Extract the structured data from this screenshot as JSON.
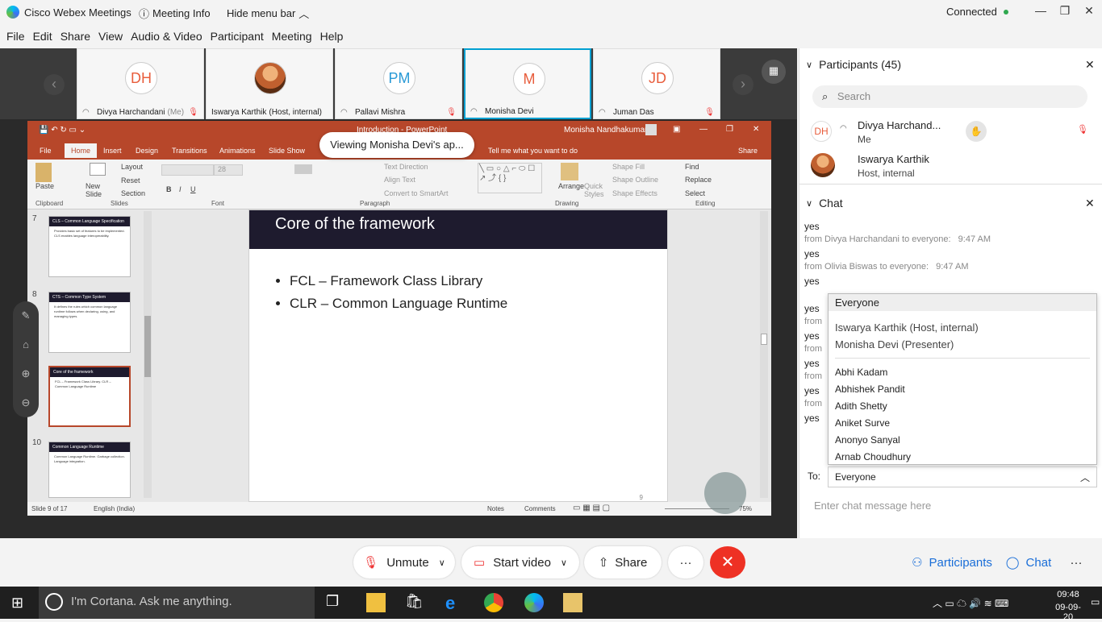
{
  "titlebar": {
    "app": "Cisco Webex Meetings",
    "meeting_info": "Meeting Info",
    "hide_menu": "Hide menu bar",
    "connection": "Connected"
  },
  "menu": [
    "File",
    "Edit",
    "Share",
    "View",
    "Audio & Video",
    "Participant",
    "Meeting",
    "Help"
  ],
  "thumbnails": [
    {
      "initials": "DH",
      "name": "Divya Harchandani",
      "suffix": "(Me)"
    },
    {
      "initials": "",
      "name": "Iswarya Karthik",
      "suffix": "(Host, internal)"
    },
    {
      "initials": "PM",
      "name": "Pallavi Mishra",
      "suffix": ""
    },
    {
      "initials": "M",
      "name": "Monisha Devi",
      "suffix": ""
    },
    {
      "initials": "JD",
      "name": "Juman Das",
      "suffix": ""
    }
  ],
  "banner": "Viewing Monisha Devi's ap...",
  "ppt": {
    "title": "Introduction - PowerPoint",
    "user": "Monisha Nandhakumar",
    "tabs": [
      "File",
      "Home",
      "Insert",
      "Design",
      "Transitions",
      "Animations",
      "Slide Show"
    ],
    "tell_me": "Tell me what you want to do",
    "share": "Share",
    "ribbon": {
      "paste": "Paste",
      "new_slide": "New Slide",
      "layout": "Layout",
      "reset": "Reset",
      "section": "Section",
      "font_size": "28",
      "text_direction": "Text Direction",
      "align_text": "Align Text",
      "convert": "Convert to SmartArt",
      "arrange": "Arrange",
      "quick_styles": "Quick Styles",
      "shape_fill": "Shape Fill",
      "shape_outline": "Shape Outline",
      "shape_effects": "Shape Effects",
      "find": "Find",
      "replace": "Replace",
      "select": "Select",
      "groups": [
        "Clipboard",
        "Slides",
        "Font",
        "Paragraph",
        "Drawing",
        "Editing"
      ]
    },
    "slides": [
      {
        "no": "7",
        "title": "CLS – Common Language Specification",
        "text": "Provides basic set of features to be implemented. CLS enables language interoperability."
      },
      {
        "no": "8",
        "title": "CTS – Common Type System",
        "text": "It defines the rules which common language runtime follows when declaring, using, and managing types."
      },
      {
        "no": "9",
        "title": "Core of the framework",
        "text": "FCL – Framework Class Library. CLR – Common Language Runtime"
      },
      {
        "no": "10",
        "title": "Common Language Runtime",
        "text": "Common Language Runtime. Garbage collection. Language integration."
      }
    ],
    "slide": {
      "heading": "Core of the framework",
      "bullets": [
        "FCL – Framework Class Library",
        "CLR – Common Language Runtime"
      ],
      "page": "9"
    },
    "status": {
      "slide": "Slide 9 of 17",
      "lang": "English (India)",
      "notes": "Notes",
      "comments": "Comments",
      "zoom": "75%"
    }
  },
  "participants": {
    "header": "Participants (45)",
    "search_placeholder": "Search",
    "list": [
      {
        "initials": "DH",
        "name": "Divya Harchand...",
        "sub": "Me"
      },
      {
        "initials": "",
        "name": "Iswarya Karthik",
        "sub": "Host, internal"
      }
    ]
  },
  "chat": {
    "header": "Chat",
    "messages": [
      {
        "text": "yes",
        "meta": "from Divya Harchandani to everyone:",
        "time": "9:47 AM"
      },
      {
        "text": "yes",
        "meta": "from Olivia Biswas to everyone:",
        "time": "9:47 AM"
      },
      {
        "text": "yes",
        "meta": "",
        "time": ""
      },
      {
        "text": "yes",
        "meta": "from",
        "time": ""
      },
      {
        "text": "yes",
        "meta": "from",
        "time": ""
      },
      {
        "text": "yes",
        "meta": "from",
        "time": ""
      },
      {
        "text": "yes",
        "meta": "from",
        "time": ""
      },
      {
        "text": "yes",
        "meta": "",
        "time": ""
      }
    ],
    "dropdown": {
      "selected": "Everyone",
      "roles": [
        "Iswarya Karthik (Host, internal)",
        "Monisha Devi (Presenter)"
      ],
      "people": [
        "Abhi Kadam",
        "Abhishek Pandit",
        "Adith Shetty",
        "Aniket Surve",
        "Anonyo Sanyal",
        "Arnab Choudhury"
      ]
    },
    "to_label": "To:",
    "to_value": "Everyone",
    "input_placeholder": "Enter chat message here"
  },
  "controls": {
    "unmute": "Unmute",
    "start_video": "Start video",
    "share": "Share",
    "participants": "Participants",
    "chat": "Chat"
  },
  "taskbar": {
    "cortana": "I'm Cortana. Ask me anything.",
    "time": "09:48",
    "date": "09-09-20"
  },
  "colors": {
    "accent": "#00a0d1",
    "ppt": "#b7472a",
    "end": "#ee3124",
    "slide_header": "#1e1b2e"
  }
}
